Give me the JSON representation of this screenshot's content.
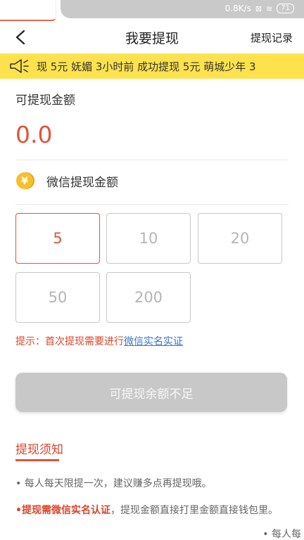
{
  "status_bar": {
    "speed": "0.8K/s",
    "battery": "71"
  },
  "nav": {
    "title": "我要提现",
    "record_label": "提现记录"
  },
  "marquee": {
    "text": "现 5元      妩媚 3小时前 成功提现 5元      萌城少年 3"
  },
  "balance": {
    "label": "可提现金额",
    "value": "0.0"
  },
  "wechat": {
    "label": "微信提现金额"
  },
  "amounts": [
    {
      "value": "5",
      "selected": true
    },
    {
      "value": "10",
      "selected": false
    },
    {
      "value": "20",
      "selected": false
    },
    {
      "value": "50",
      "selected": false
    },
    {
      "value": "200",
      "selected": false
    }
  ],
  "tip": {
    "prefix": "提示：首次提现需要进行",
    "link": "微信实名实证"
  },
  "submit_button": {
    "label": "可提现余额不足"
  },
  "notice": {
    "title": "提现须知",
    "item1": "• 每人每天限提一次，建议赚多点再提现哦。",
    "item2_highlight": "•提现需微信实名认证",
    "item2_rest": "，提现金额直接打里金额直接钱包里。",
    "floating": "• 每人每"
  },
  "colors": {
    "accent": "#e0543a",
    "marquee_bg": "#fde24e",
    "link": "#3a76c4",
    "disabled_button": "#c8c8c8"
  }
}
